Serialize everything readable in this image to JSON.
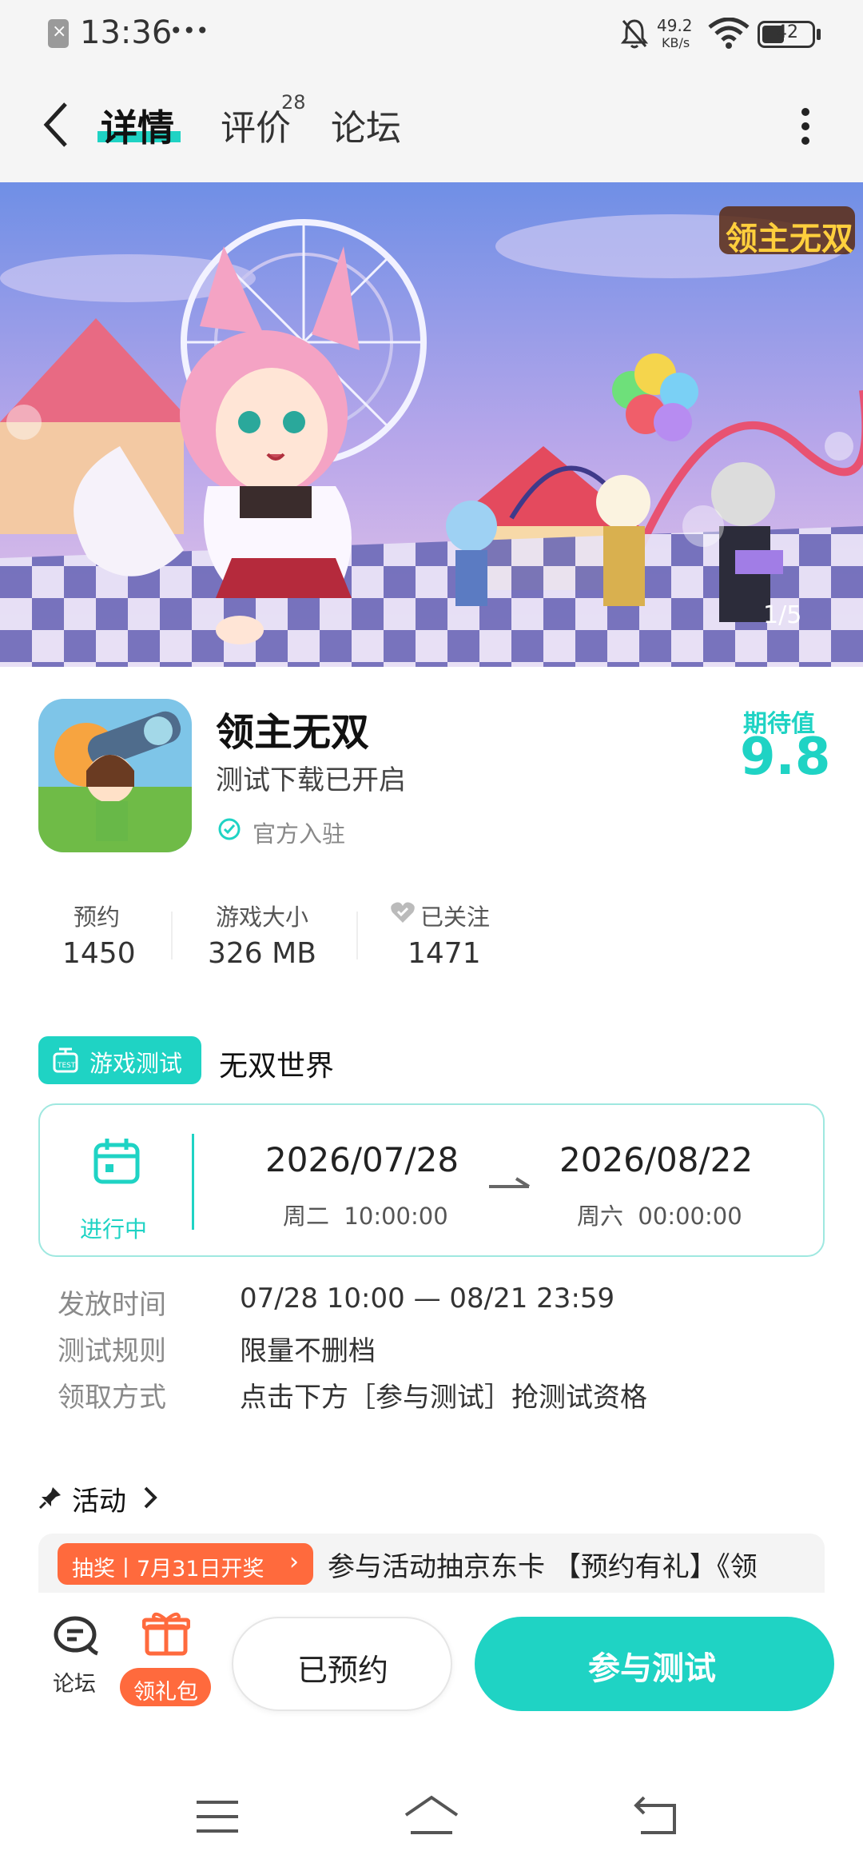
{
  "status_bar": {
    "time": "13:36",
    "more": "•••",
    "net_speed_value": "49.2",
    "net_speed_unit": "KB/s",
    "battery": "42",
    "icons": [
      "sim-off-icon",
      "mute-icon",
      "wifi-icon",
      "battery-icon"
    ]
  },
  "nav": {
    "tabs": [
      {
        "label": "详情",
        "active": true
      },
      {
        "label": "评价",
        "badge": "28"
      },
      {
        "label": "论坛"
      }
    ]
  },
  "banner": {
    "logo_text": "领主无双",
    "counter": "1/5"
  },
  "game": {
    "name": "领主无双",
    "subtitle": "测试下载已开启",
    "official": "官方入驻",
    "expect_label": "期待值",
    "expect_value": "9.8"
  },
  "stats": [
    {
      "label": "预约",
      "value": "1450"
    },
    {
      "label": "游戏大小",
      "value": "326 MB"
    },
    {
      "label": "已关注",
      "value": "1471"
    }
  ],
  "test": {
    "badge": "游戏测试",
    "name": "无双世界",
    "status": "进行中",
    "start_date": "2026/07/28",
    "start_time": "周二  10:00:00",
    "end_date": "2026/08/22",
    "end_time": "周六  00:00:00",
    "info": [
      {
        "label": "发放时间",
        "value": "07/28 10:00 — 08/21 23:59"
      },
      {
        "label": "测试规则",
        "value": "限量不删档"
      },
      {
        "label": "领取方式",
        "value": "点击下方［参与测试］抢测试资格"
      }
    ]
  },
  "activity": {
    "title": "活动",
    "tag": "抽奖丨7月31日开奖",
    "text": "参与活动抽京东卡 【预约有礼】《领"
  },
  "bottom": {
    "forum": "论坛",
    "gift": "领礼包",
    "reserved": "已预约",
    "join": "参与测试"
  },
  "colors": {
    "accent": "#1fd3c4",
    "activity_tag": "#ff6a3d",
    "gift": "#ff6a3d"
  }
}
